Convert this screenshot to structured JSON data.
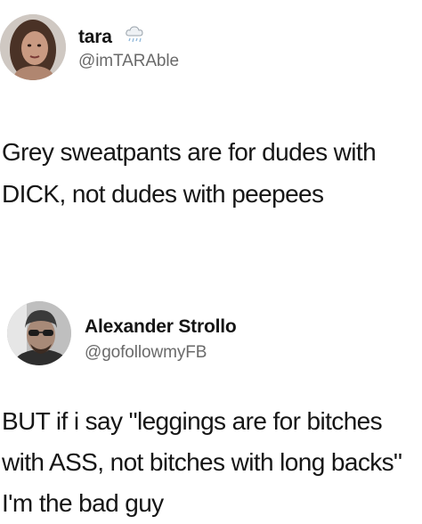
{
  "tweets": [
    {
      "author": {
        "name": "tara",
        "handle": "@imTARAble",
        "badge_icon": "cloud-rain-icon"
      },
      "body_lines": [
        "Grey sweatpants are for dudes with",
        "DICK, not dudes with peepees"
      ]
    },
    {
      "author": {
        "name": "Alexander Strollo",
        "handle": "@gofollowmyFB"
      },
      "body_lines": [
        "BUT if i say \"leggings are for bitches",
        "with ASS, not bitches with long backs\"",
        "I'm the bad guy"
      ]
    }
  ],
  "colors": {
    "text": "#161616",
    "handle": "#6a6a6a",
    "background": "#ffffff"
  }
}
